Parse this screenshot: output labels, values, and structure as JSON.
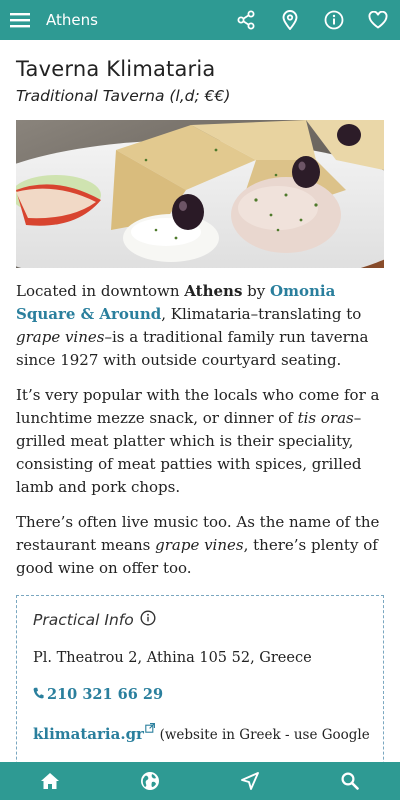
{
  "appbar": {
    "title": "Athens",
    "icons": [
      "menu-icon",
      "share-icon",
      "map-pin-icon",
      "info-icon",
      "heart-icon"
    ]
  },
  "place": {
    "name": "Taverna Klimataria",
    "subtitle": "Traditional Taverna (l,d; €€)"
  },
  "paragraphs": {
    "p1_a": "Located in downtown ",
    "p1_b": "Athens",
    "p1_c": " by ",
    "p1_link": "Omonia Square & Around",
    "p1_d": ", Klimataria–translating to ",
    "p1_e": "grape vines",
    "p1_f": "–is a traditional family run taverna since 1927 with outside courtyard seating.",
    "p2_a": "It’s very popular with the locals who come for a lunchtime mezze snack, or dinner of ",
    "p2_b": "tis oras",
    "p2_c": "–grilled meat platter which is their speciality, consisting of meat patties with spices, grilled lamb and pork chops.",
    "p3_a": "There’s often live music too. As the name of the restaurant means ",
    "p3_b": "grape vines",
    "p3_c": ", there’s plenty of good wine on offer too."
  },
  "practical": {
    "title": "Practical Info",
    "address": "Pl. Theatrou 2, Athina 105 52, Greece",
    "phone": "210 321 66 29",
    "website": "klimataria.gr",
    "website_note": "(website in Greek - use Google"
  },
  "bottombar": {
    "icons": [
      "home-icon",
      "globe-icon",
      "navigation-icon",
      "search-icon"
    ]
  },
  "colors": {
    "accent": "#2e9a93",
    "link": "#2a7f9d"
  }
}
